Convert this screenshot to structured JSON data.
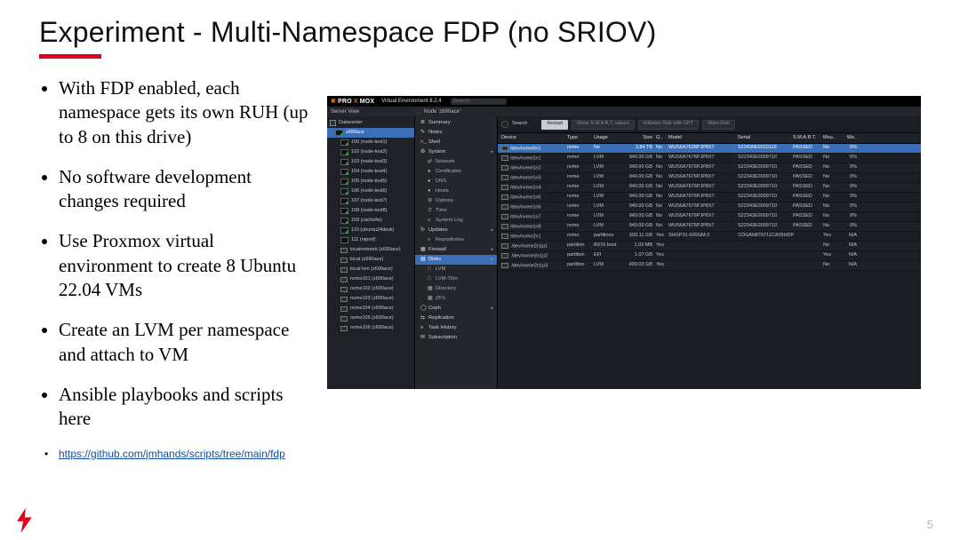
{
  "title": "Experiment - Multi-Namespace FDP (no SRIOV)",
  "bullets": [
    "With FDP enabled, each namespace gets its own RUH (up to 8 on this drive)",
    "No software development changes required",
    "Use Proxmox virtual environment to create 8 Ubuntu 22.04 VMs",
    "Create an LVM per namespace and attach to VM",
    "Ansible playbooks and scripts here"
  ],
  "link": {
    "label": "https://github.com/jmhands/scripts/tree/main/fdp",
    "href": "https://github.com/jmhands/scripts/tree/main/fdp"
  },
  "pageNumber": "5",
  "shot": {
    "brand": {
      "pre": "PRO",
      "mid": "X",
      "post": "MOX"
    },
    "version": "Virtual Environment 8.2.4",
    "searchPlaceholder": "Search",
    "serverView": "Server View",
    "nodePath": "Node 'z690ace'",
    "tree": [
      {
        "label": "Datacenter",
        "kind": "dc",
        "sel": false,
        "indent": 0
      },
      {
        "label": "z690ace",
        "kind": "vm",
        "sel": true,
        "on": true,
        "indent": 1
      },
      {
        "label": "100 (node-test1)",
        "kind": "vm",
        "on": true,
        "indent": 2
      },
      {
        "label": "102 (node-test2)",
        "kind": "vm",
        "on": true,
        "indent": 2
      },
      {
        "label": "103 (node-test3)",
        "kind": "vm",
        "on": true,
        "indent": 2
      },
      {
        "label": "104 (node-test4)",
        "kind": "vm",
        "on": true,
        "indent": 2
      },
      {
        "label": "105 (node-test5)",
        "kind": "vm",
        "on": true,
        "indent": 2
      },
      {
        "label": "106 (node-test6)",
        "kind": "vm",
        "on": true,
        "indent": 2
      },
      {
        "label": "107 (node-test7)",
        "kind": "vm",
        "on": true,
        "indent": 2
      },
      {
        "label": "108 (node-test8)",
        "kind": "vm",
        "on": true,
        "indent": 2
      },
      {
        "label": "109 (cachefio)",
        "kind": "vm",
        "on": true,
        "indent": 2
      },
      {
        "label": "110 (ubuntu24desk)",
        "kind": "vm",
        "on": true,
        "indent": 2
      },
      {
        "label": "111 (ntpref)",
        "kind": "vm",
        "on": false,
        "indent": 2
      },
      {
        "label": "localnetwork (z690ace)",
        "kind": "st",
        "indent": 2
      },
      {
        "label": "local (z690ace)",
        "kind": "st",
        "indent": 2
      },
      {
        "label": "local-lvm (z690ace)",
        "kind": "st",
        "indent": 2
      },
      {
        "label": "nvme101 (z690ace)",
        "kind": "st",
        "indent": 2
      },
      {
        "label": "nvme102 (z690ace)",
        "kind": "st",
        "indent": 2
      },
      {
        "label": "nvme103 (z690ace)",
        "kind": "st",
        "indent": 2
      },
      {
        "label": "nvme104 (z690ace)",
        "kind": "st",
        "indent": 2
      },
      {
        "label": "nvme105 (z690ace)",
        "kind": "st",
        "indent": 2
      },
      {
        "label": "nvme106 (z690ace)",
        "kind": "st",
        "indent": 2
      }
    ],
    "nav": [
      {
        "label": "Summary",
        "icon": "≣"
      },
      {
        "label": "Notes",
        "icon": "✎"
      },
      {
        "label": "Shell",
        "icon": ">_"
      },
      {
        "label": "System",
        "icon": "⚙",
        "caret": true
      },
      {
        "label": "Network",
        "icon": "⇄",
        "sub": true,
        "caret": false,
        "selGroup": false,
        "arrow": true
      },
      {
        "label": "Certificates",
        "icon": "●",
        "sub": true
      },
      {
        "label": "DNS",
        "icon": "●",
        "sub": true
      },
      {
        "label": "Hosts",
        "icon": "●",
        "sub": true
      },
      {
        "label": "Options",
        "icon": "⚙",
        "sub": true
      },
      {
        "label": "Time",
        "icon": "⏱",
        "sub": true
      },
      {
        "label": "System Log",
        "icon": "≡",
        "sub": true
      },
      {
        "label": "Updates",
        "icon": "↻",
        "caret": true
      },
      {
        "label": "Repositories",
        "icon": "≡",
        "sub": true
      },
      {
        "label": "Firewall",
        "icon": "▦",
        "caret": true
      },
      {
        "label": "Disks",
        "icon": "▤",
        "sel": true,
        "caret": true
      },
      {
        "label": "LVM",
        "icon": "□",
        "sub": true
      },
      {
        "label": "LVM-Thin",
        "icon": "□",
        "sub": true
      },
      {
        "label": "Directory",
        "icon": "▦",
        "sub": true
      },
      {
        "label": "ZFS",
        "icon": "▦",
        "sub": true
      },
      {
        "label": "Ceph",
        "icon": "◯",
        "caret": true
      },
      {
        "label": "Replication",
        "icon": "⇆"
      },
      {
        "label": "Task History",
        "icon": "≡"
      },
      {
        "label": "Subscription",
        "icon": "✉"
      }
    ],
    "toolbar": {
      "search": "Search",
      "buttons": [
        "Reload",
        "Show S.M.A.R.T. values",
        "Initialize Disk with GPT",
        "Wipe Disk"
      ]
    },
    "columns": [
      "Device",
      "Type",
      "Usage",
      "Size",
      "G..",
      "Model",
      "Serial",
      "S.M.A.R.T.",
      "Mou..",
      "We.."
    ],
    "rows": [
      {
        "sel": true,
        "c": [
          "/dev/nvme0n1",
          "nvme",
          "No",
          "3.84 TB",
          "No",
          "WUS6A7638PJP8X7",
          "S22430E0010110",
          "PASSED",
          "No",
          "0%"
        ]
      },
      {
        "c": [
          "/dev/nvme1n1",
          "nvme",
          "LVM",
          "940.00 GB",
          "No",
          "WUS6A7676PJP8X7",
          "S22343E0009710",
          "PASSED",
          "No",
          "0%"
        ]
      },
      {
        "c": [
          "/dev/nvme1n2",
          "nvme",
          "LVM",
          "940.00 GB",
          "No",
          "WUS6A7676PJP8X7",
          "S22343E0009710",
          "PASSED",
          "No",
          "0%"
        ]
      },
      {
        "c": [
          "/dev/nvme1n3",
          "nvme",
          "LVM",
          "940.00 GB",
          "No",
          "WUS6A7676PJP8X7",
          "S22343E0009710",
          "PASSED",
          "No",
          "0%"
        ]
      },
      {
        "c": [
          "/dev/nvme1n4",
          "nvme",
          "LVM",
          "940.00 GB",
          "No",
          "WUS6A7676PJP8X7",
          "S22343E0009710",
          "PASSED",
          "No",
          "0%"
        ]
      },
      {
        "c": [
          "/dev/nvme1n5",
          "nvme",
          "LVM",
          "940.00 GB",
          "No",
          "WUS6A7676PJP8X7",
          "S22343E0009710",
          "PASSED",
          "No",
          "0%"
        ]
      },
      {
        "c": [
          "/dev/nvme1n6",
          "nvme",
          "LVM",
          "940.00 GB",
          "No",
          "WUS6A7676PJP8X7",
          "S22343E0009710",
          "PASSED",
          "No",
          "0%"
        ]
      },
      {
        "c": [
          "/dev/nvme1n7",
          "nvme",
          "LVM",
          "940.00 GB",
          "No",
          "WUS6A7676PJP8X7",
          "S22343E0009710",
          "PASSED",
          "No",
          "0%"
        ]
      },
      {
        "c": [
          "/dev/nvme1n8",
          "nvme",
          "LVM",
          "940.00 GB",
          "No",
          "WUS6A7676PJP8X7",
          "S22343E0009710",
          "PASSED",
          "No",
          "0%"
        ]
      },
      {
        "c": [
          "/dev/nvme2n1",
          "nvme",
          "partitions",
          "500.11 GB",
          "Yes",
          "SHGP31-500GM-2",
          "CDGAN879711CA05HDP",
          "",
          "Yes",
          "N/A"
        ]
      },
      {
        "c": [
          "  /dev/nvme2n1p1",
          "partition",
          "BIOS boot",
          "1.03 MB",
          "Yes",
          "",
          "",
          "",
          "No",
          "N/A"
        ]
      },
      {
        "c": [
          "  /dev/nvme2n1p2",
          "partition",
          "EFI",
          "1.07 GB",
          "Yes",
          "",
          "",
          "",
          "Yes",
          "N/A"
        ]
      },
      {
        "c": [
          "  /dev/nvme2n1p3",
          "partition",
          "LVM",
          "499.03 GB",
          "Yes",
          "",
          "",
          "",
          "No",
          "N/A"
        ]
      }
    ]
  }
}
